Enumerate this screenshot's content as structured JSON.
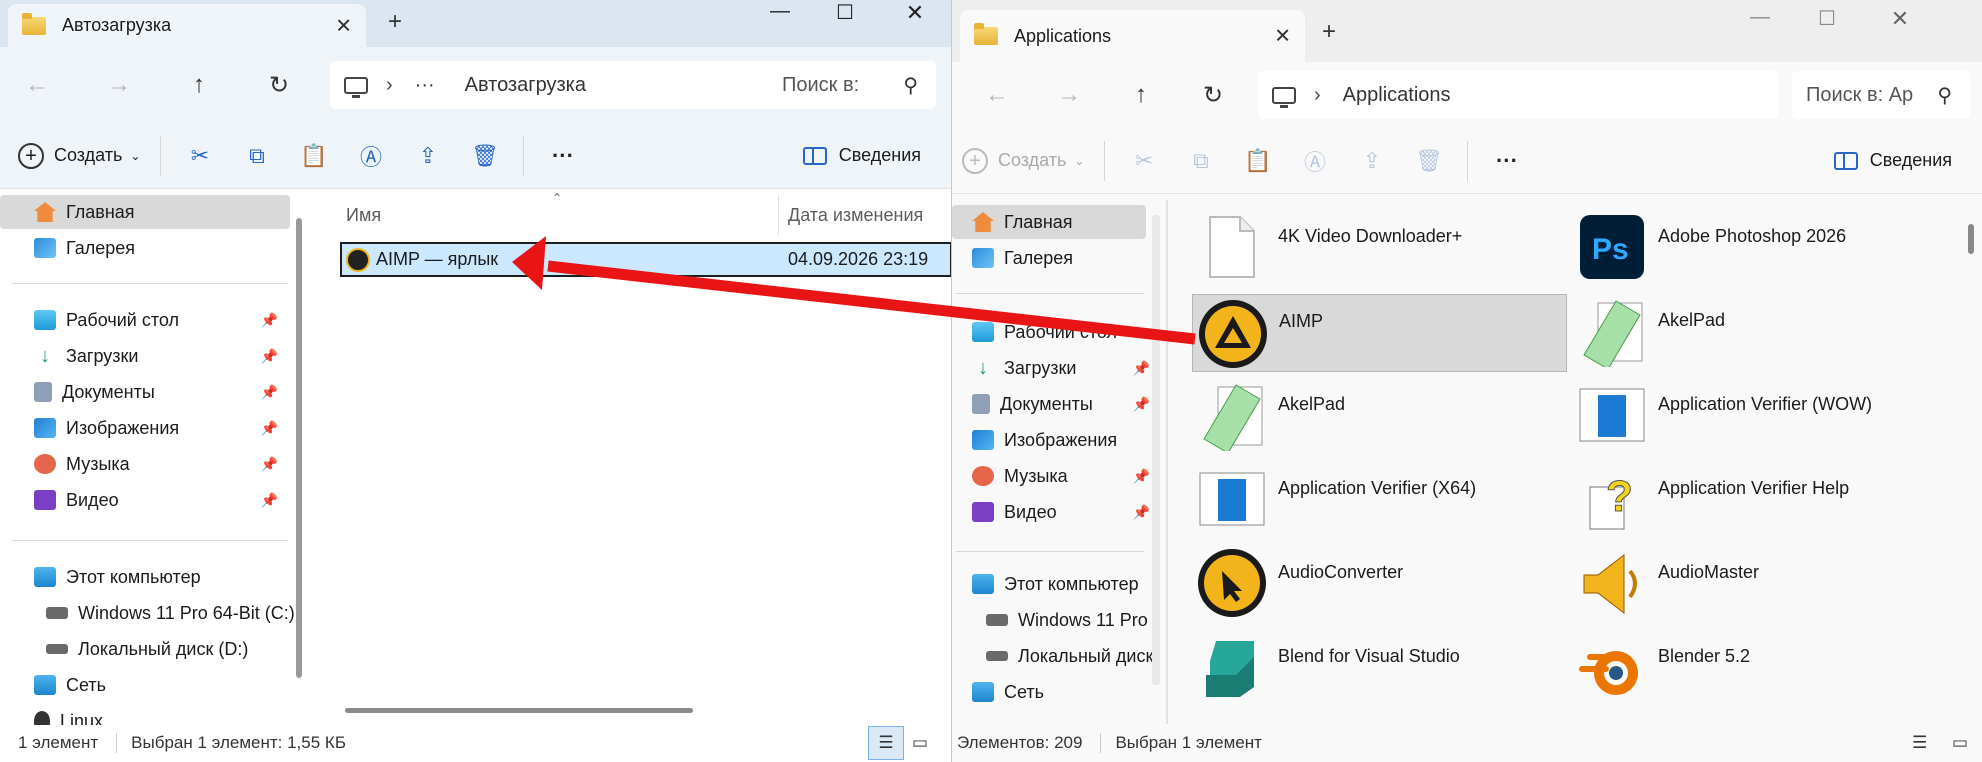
{
  "left_window": {
    "tab_title": "Автозагрузка",
    "breadcrumb_more": "···",
    "breadcrumb_current": "Автозагрузка",
    "search_placeholder": "Поиск в:",
    "toolbar": {
      "create": "Создать",
      "details": "Сведения"
    },
    "sidebar": {
      "home": "Главная",
      "gallery": "Галерея",
      "desktop": "Рабочий стол",
      "downloads": "Загрузки",
      "documents": "Документы",
      "pictures": "Изображения",
      "music": "Музыка",
      "videos": "Видео",
      "this_pc": "Этот компьютер",
      "drive_c": "Windows 11 Pro 64-Bit (C:)",
      "drive_d": "Локальный диск (D:)",
      "network": "Сеть",
      "linux": "Linux"
    },
    "columns": {
      "name": "Имя",
      "date": "Дата изменения"
    },
    "file": {
      "name": "AIMP — ярлык",
      "date": "04.09.2026 23:19"
    },
    "status": {
      "count": "1 элемент",
      "selected": "Выбран 1 элемент: 1,55 КБ"
    }
  },
  "right_window": {
    "tab_title": "Applications",
    "breadcrumb_current": "Applications",
    "search_placeholder": "Поиск в: Ар",
    "toolbar": {
      "create": "Создать",
      "details": "Сведения"
    },
    "sidebar": {
      "home": "Главная",
      "gallery": "Галерея",
      "desktop": "Рабочий стол",
      "downloads": "Загрузки",
      "documents": "Документы",
      "pictures": "Изображения",
      "music": "Музыка",
      "videos": "Видео",
      "this_pc": "Этот компьютер",
      "drive_c": "Windows 11 Pro",
      "drive_d": "Локальный диск",
      "network": "Сеть"
    },
    "apps": [
      {
        "name": "4K Video Downloader+",
        "icon": "blank-file-icon"
      },
      {
        "name": "Adobe Photoshop 2026",
        "icon": "photoshop-icon"
      },
      {
        "name": "AIMP",
        "icon": "aimp-icon"
      },
      {
        "name": "AkelPad",
        "icon": "akelpad-icon"
      },
      {
        "name": "AkelPad",
        "icon": "akelpad-icon"
      },
      {
        "name": "Application Verifier (WOW)",
        "icon": "app-verifier-icon"
      },
      {
        "name": "Application Verifier (X64)",
        "icon": "app-verifier-icon"
      },
      {
        "name": "Application Verifier Help",
        "icon": "help-doc-icon"
      },
      {
        "name": "AudioConverter",
        "icon": "audioconverter-icon"
      },
      {
        "name": "AudioMaster",
        "icon": "audiomaster-icon"
      },
      {
        "name": "Blend for Visual Studio",
        "icon": "blend-icon"
      },
      {
        "name": "Blender 5.2",
        "icon": "blender-icon"
      }
    ],
    "status": {
      "count": "Элементов: 209",
      "selected": "Выбран 1 элемент"
    }
  },
  "colors": {
    "arrow": "#e81416",
    "selection": "#cce8ff",
    "accent": "#2966c4"
  }
}
